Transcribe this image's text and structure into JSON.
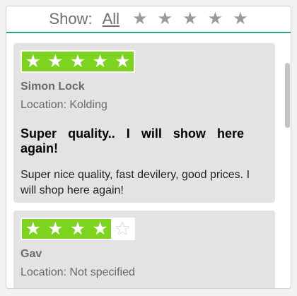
{
  "filter": {
    "show_label": "Show:",
    "all_label": "All",
    "star_glyph": "★",
    "star_options": [
      "★",
      "★",
      "★",
      "★",
      "★"
    ]
  },
  "reviews": [
    {
      "rating": 5,
      "max_rating": 5,
      "name": "Simon Lock",
      "location": "Location: Kolding",
      "title": "Super quality.. I will show here again!",
      "body": "Super nice quality, fast devilery, good prices. I will shop here again!"
    },
    {
      "rating": 4,
      "max_rating": 5,
      "name": "Gav",
      "location": "Location: Not specified"
    }
  ],
  "colors": {
    "accent_line": "#2aa876",
    "star_fill": "#7ed321",
    "card_bg": "#e3e3e3"
  }
}
